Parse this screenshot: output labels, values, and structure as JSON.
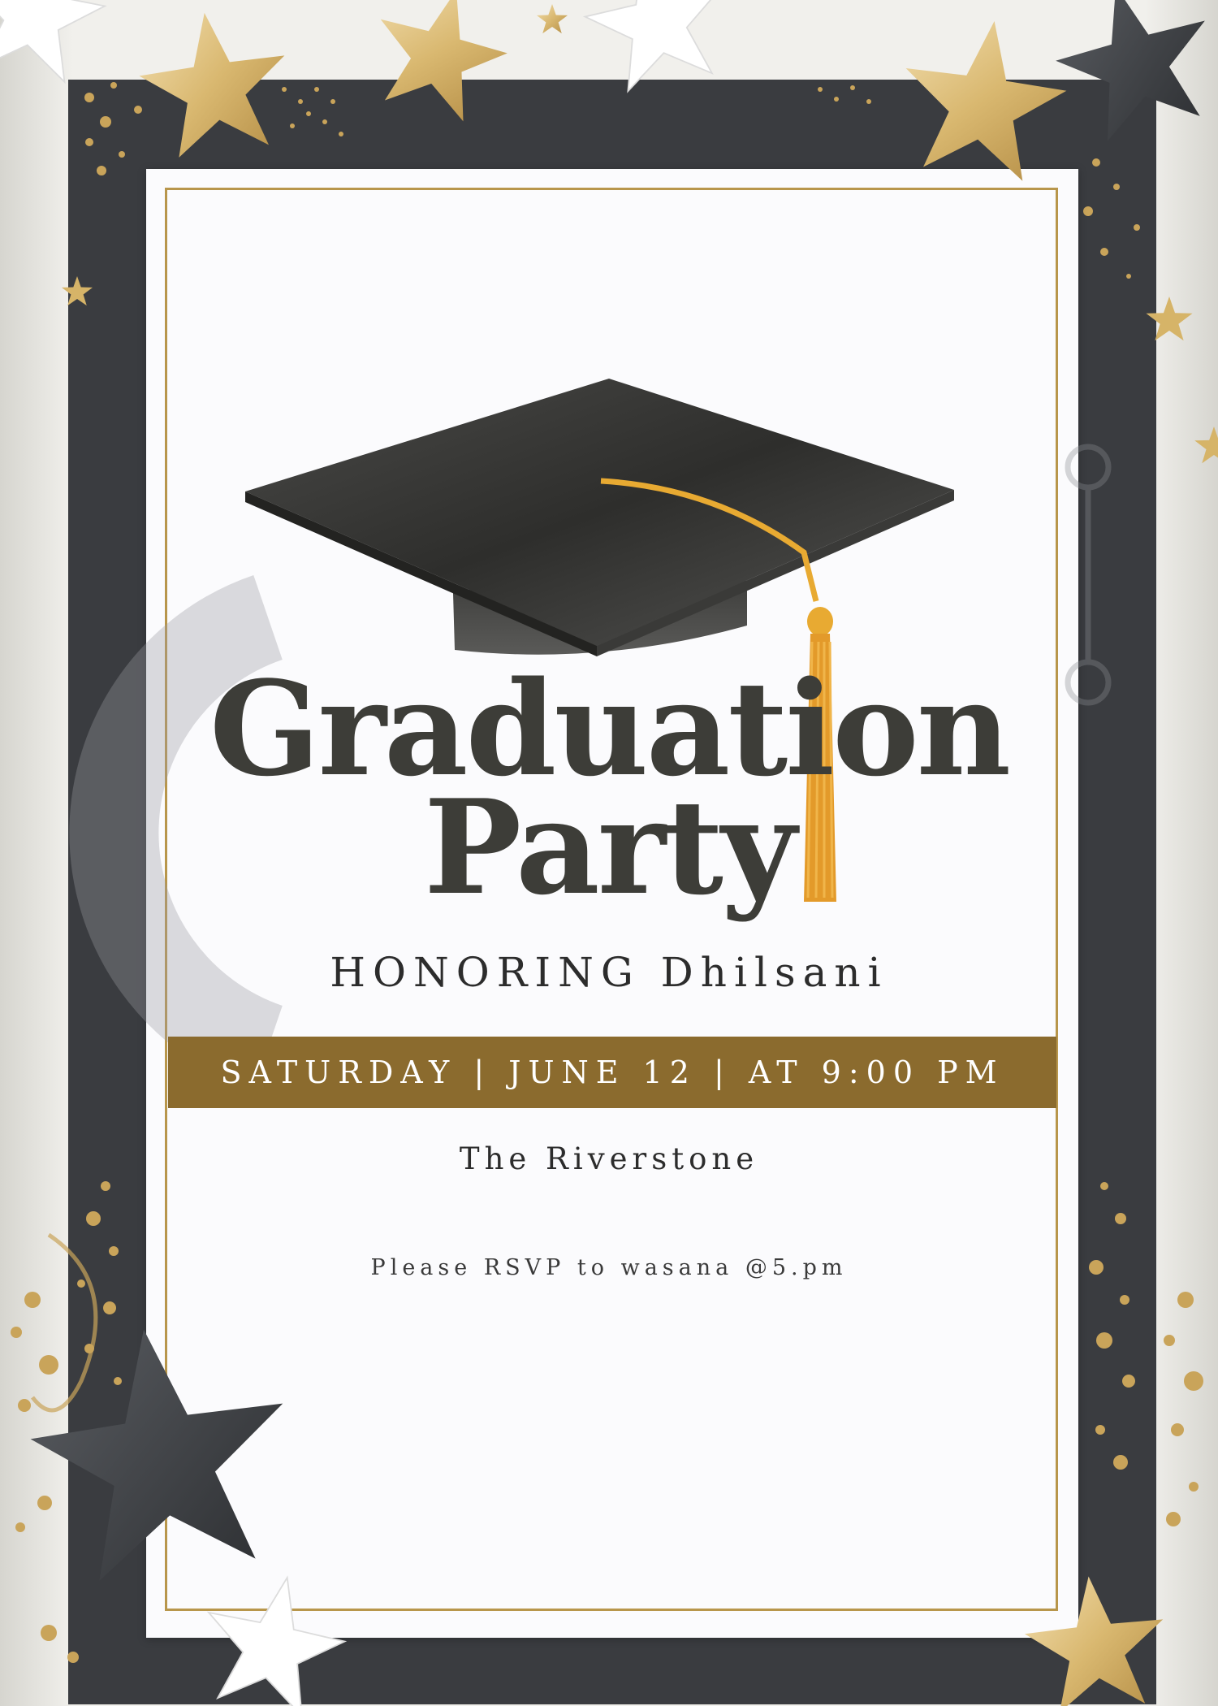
{
  "invitation": {
    "title_line1": "Graduation",
    "title_line2": "Party",
    "honoree": "HONORING Dhilsani",
    "date_line": "SATURDAY | JUNE 12 | AT 9:00 PM",
    "venue": "The Riverstone",
    "rsvp": "Please RSVP to wasana @5.pm"
  },
  "colors": {
    "frame": "#3a3c40",
    "gold": "#b8964b",
    "band": "#8b6b2e",
    "text": "#3d3d38"
  },
  "icons": [
    "graduation-cap-icon",
    "star-icon",
    "confetti-dots"
  ]
}
